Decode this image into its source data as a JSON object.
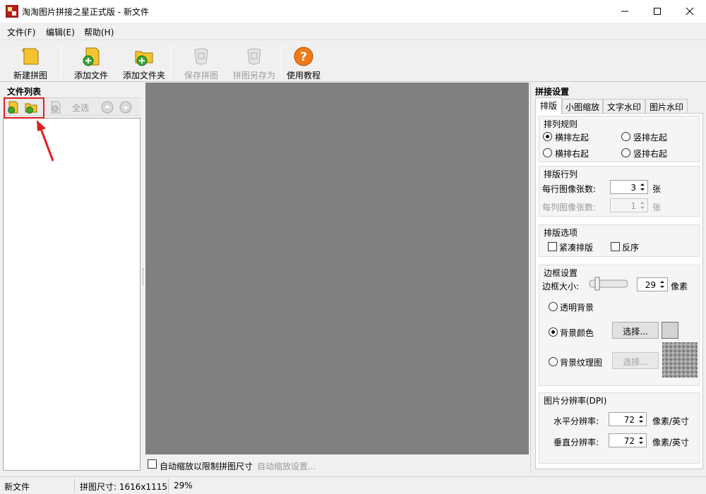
{
  "window": {
    "title": "淘淘图片拼接之星正式版 - 新文件",
    "accent_color": "#b91c1c"
  },
  "menu": {
    "items": [
      "文件(F)",
      "编辑(E)",
      "帮助(H)"
    ]
  },
  "toolbar": {
    "new_label": "新建拼图",
    "add_file_label": "添加文件",
    "add_folder_label": "添加文件夹",
    "save_label": "保存拼图",
    "save_as_label": "拼图另存为",
    "tutorial_label": "使用教程"
  },
  "file_list": {
    "title": "文件列表",
    "select_all_label": "全选",
    "highlight_color": "#e02020"
  },
  "canvas": {
    "background_color": "#808080",
    "auto_zoom_label": "自动缩放以限制拼图尺寸",
    "auto_zoom_settings_label": "自动缩放设置..."
  },
  "settings": {
    "title": "拼接设置",
    "tabs": [
      "排版",
      "小图缩放",
      "文字水印",
      "图片水印"
    ],
    "arrange": {
      "title": "排列规则",
      "options": [
        "横排左起",
        "竖排左起",
        "横排右起",
        "竖排右起"
      ],
      "selected": "横排左起"
    },
    "rows_cols": {
      "title": "排版行列",
      "per_row_label": "每行图像张数:",
      "per_row_value": "3",
      "per_col_label": "每列图像张数:",
      "per_col_value": "1",
      "unit": "张"
    },
    "layout_options": {
      "title": "排版选项",
      "compact_label": "紧凑排版",
      "reverse_label": "反序"
    },
    "border": {
      "title": "边框设置",
      "size_label": "边框大小:",
      "size_value": "29",
      "size_unit": "像素",
      "transparent_label": "透明背景",
      "color_label": "背景颜色",
      "texture_label": "背景纹理图",
      "choose_label": "选择...",
      "choose_disabled_label": "选择...",
      "swatch_color": "#d4d4d4"
    },
    "dpi": {
      "title": "图片分辨率(DPI)",
      "h_label": "水平分辨率:",
      "h_value": "72",
      "v_label": "垂直分辨率:",
      "v_value": "72",
      "unit": "像素/英寸"
    }
  },
  "status": {
    "file": "新文件",
    "size": "拼图尺寸: 1616x1115",
    "zoom": "29%"
  }
}
